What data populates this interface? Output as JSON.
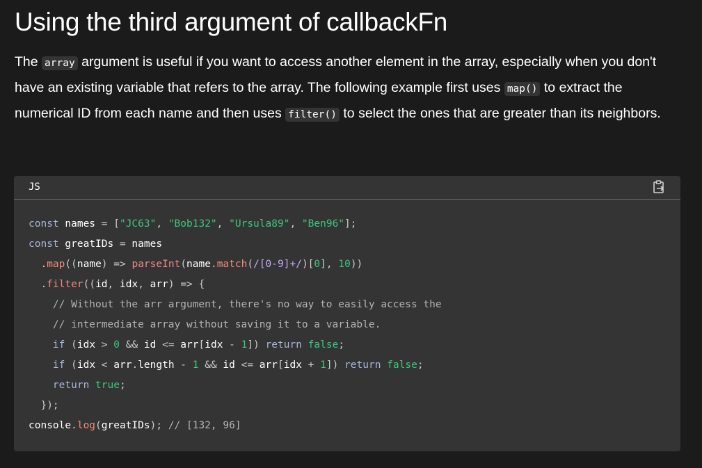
{
  "heading": "Using the third argument of callbackFn",
  "paragraph": {
    "t1": "The ",
    "c1": "array",
    "t2": " argument is useful if you want to access another element in the array, especially when you don't have an existing variable that refers to the array. The following example first uses ",
    "c2": "map()",
    "t3": " to extract the numerical ID from each name and then uses ",
    "c3": "filter()",
    "t4": " to select the ones that are greater than its neighbors."
  },
  "code_block": {
    "language": "JS",
    "copy_icon": "clipboard-icon",
    "lines": [
      "const names = [\"JC63\", \"Bob132\", \"Ursula89\", \"Ben96\"];",
      "const greatIDs = names",
      "  .map((name) => parseInt(name.match(/[0-9]+/)[0], 10))",
      "  .filter((id, idx, arr) => {",
      "    // Without the arr argument, there's no way to easily access the",
      "    // intermediate array without saving it to a variable.",
      "    if (idx > 0 && id <= arr[idx - 1]) return false;",
      "    if (idx < arr.length - 1 && id <= arr[idx + 1]) return false;",
      "    return true;",
      "  });",
      "console.log(greatIDs); // [132, 96]"
    ]
  },
  "colors": {
    "background": "#1b1b1b",
    "code_background": "#343434",
    "string": "#3fc67d",
    "keyword": "#a8b6d8",
    "function": "#f28a7e",
    "comment": "#b4b4b4"
  }
}
